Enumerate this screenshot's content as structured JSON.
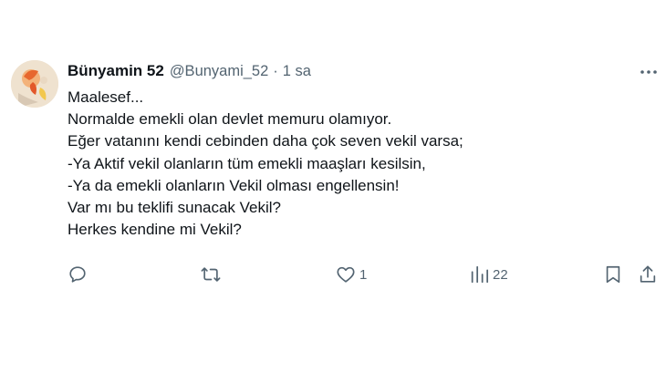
{
  "tweet": {
    "display_name": "Bünyamin 52",
    "handle": "@Bunyami_52",
    "separator": "·",
    "time": "1 sa",
    "lines": [
      "Maalesef...",
      "Normalde emekli olan devlet memuru olamıyor.",
      "Eğer vatanını kendi cebinden daha çok seven vekil varsa;",
      "-Ya Aktif vekil olanların tüm emekli maaşları kesilsin,",
      "-Ya da emekli olanların Vekil olması engellensin!",
      "Var mı bu teklifi sunacak Vekil?",
      "Herkes kendine mi Vekil?"
    ]
  },
  "actions": {
    "reply_icon": "reply-icon",
    "retweet_icon": "retweet-icon",
    "like_icon": "heart-icon",
    "like_count": "1",
    "views_icon": "views-icon",
    "views_count": "22",
    "bookmark_icon": "bookmark-icon",
    "share_icon": "share-icon",
    "more_icon": "more-icon"
  },
  "colors": {
    "text": "#0f1419",
    "secondary": "#536471",
    "background": "#ffffff"
  }
}
